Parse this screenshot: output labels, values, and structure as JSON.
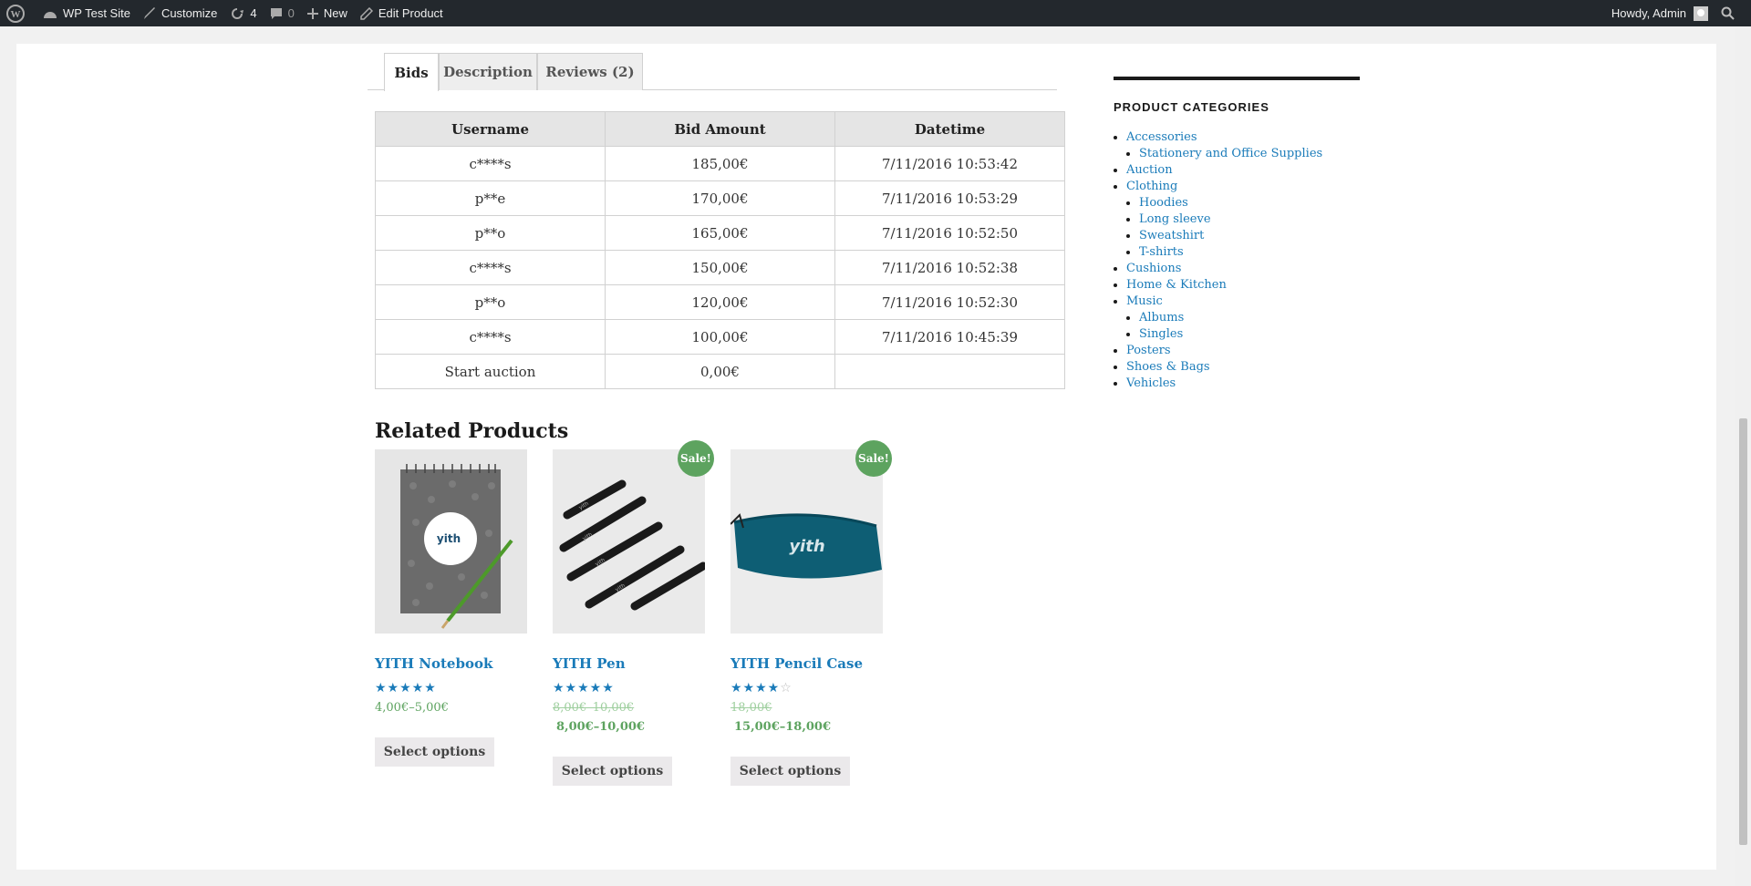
{
  "adminbar": {
    "site_name": "WP Test Site",
    "customize": "Customize",
    "updates": "4",
    "comments": "0",
    "new": "New",
    "edit_product": "Edit Product",
    "howdy": "Howdy, Admin"
  },
  "tabs": [
    {
      "label": "Bids",
      "active": true
    },
    {
      "label": "Description",
      "active": false
    },
    {
      "label": "Reviews (2)",
      "active": false
    }
  ],
  "bids_table": {
    "headers": [
      "Username",
      "Bid Amount",
      "Datetime"
    ],
    "rows": [
      [
        "c****s",
        "185,00€",
        "7/11/2016 10:53:42"
      ],
      [
        "p**e",
        "170,00€",
        "7/11/2016 10:53:29"
      ],
      [
        "p**o",
        "165,00€",
        "7/11/2016 10:52:50"
      ],
      [
        "c****s",
        "150,00€",
        "7/11/2016 10:52:38"
      ],
      [
        "p**o",
        "120,00€",
        "7/11/2016 10:52:30"
      ],
      [
        "c****s",
        "100,00€",
        "7/11/2016 10:45:39"
      ],
      [
        "Start auction",
        "0,00€",
        ""
      ]
    ]
  },
  "related": {
    "heading": "Related Products",
    "products": [
      {
        "title": "YITH Notebook",
        "rating": 5,
        "sale": false,
        "sale_label": "",
        "old_price": "",
        "price": "4,00€–5,00€",
        "button": "Select options"
      },
      {
        "title": "YITH Pen",
        "rating": 5,
        "sale": true,
        "sale_label": "Sale!",
        "old_price": "8,00€–10,00€",
        "price": "8,00€–10,00€",
        "button": "Select options"
      },
      {
        "title": "YITH Pencil Case",
        "rating": 3.5,
        "sale": true,
        "sale_label": "Sale!",
        "old_price": "18,00€",
        "price": "15,00€–18,00€",
        "button": "Select options"
      }
    ]
  },
  "sidebar": {
    "heading": "PRODUCT CATEGORIES",
    "categories": [
      {
        "label": "Accessories",
        "children": [
          "Stationery and Office Supplies"
        ]
      },
      {
        "label": "Auction",
        "children": []
      },
      {
        "label": "Clothing",
        "children": [
          "Hoodies",
          "Long sleeve",
          "Sweatshirt",
          "T-shirts"
        ]
      },
      {
        "label": "Cushions",
        "children": []
      },
      {
        "label": "Home & Kitchen",
        "children": []
      },
      {
        "label": "Music",
        "children": [
          "Albums",
          "Singles"
        ]
      },
      {
        "label": "Posters",
        "children": []
      },
      {
        "label": "Shoes & Bags",
        "children": []
      },
      {
        "label": "Vehicles",
        "children": []
      }
    ]
  },
  "colors": {
    "link": "#1a7bb9",
    "sale": "#5da35f",
    "adminbar": "#23282d"
  }
}
